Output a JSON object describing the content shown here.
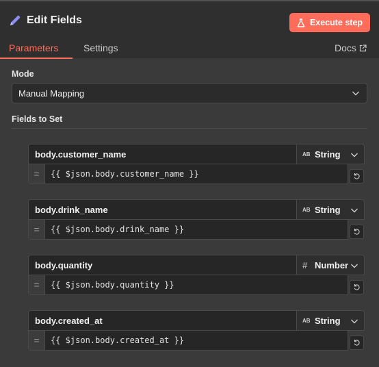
{
  "header": {
    "title": "Edit Fields",
    "execute_label": "Execute step",
    "accent": "#ff6d5a"
  },
  "tabs": [
    {
      "label": "Parameters",
      "active": true
    },
    {
      "label": "Settings",
      "active": false
    }
  ],
  "docs_label": "Docs",
  "mode": {
    "label": "Mode",
    "value": "Manual Mapping"
  },
  "fields_section": {
    "label": "Fields to Set",
    "fields": [
      {
        "name": "body.customer_name",
        "type_icon": "AB",
        "type": "String",
        "value": "{{ $json.body.customer_name }}"
      },
      {
        "name": "body.drink_name",
        "type_icon": "AB",
        "type": "String",
        "value": "{{ $json.body.drink_name }}"
      },
      {
        "name": "body.quantity",
        "type_icon": "#",
        "type": "Number",
        "value": "{{ $json.body.quantity }}"
      },
      {
        "name": "body.created_at",
        "type_icon": "AB",
        "type": "String",
        "value": "{{ $json.body.created_at }}"
      }
    ]
  },
  "icons": {
    "title": "pencil-icon",
    "execute": "flask-icon",
    "docs": "external-link-icon",
    "dropdown": "chevron-down-icon",
    "reset": "reset-icon"
  }
}
